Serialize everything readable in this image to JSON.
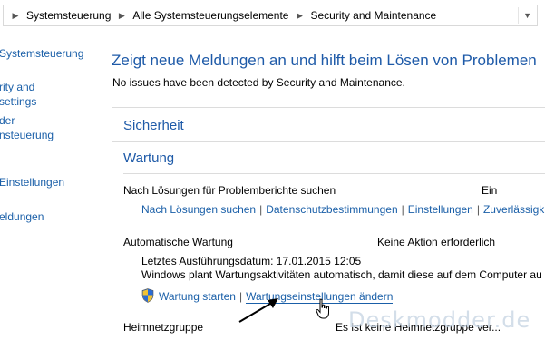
{
  "address_bar": {
    "crumbs": [
      "Systemsteuerung",
      "Alle Systemsteuerungselemente",
      "Security and Maintenance"
    ]
  },
  "left_pane": {
    "items": [
      {
        "lines": [
          "Systemsteuerung"
        ]
      },
      {
        "lines": [
          "rity and",
          "settings"
        ]
      },
      {
        "lines": [
          "der",
          "nsteuerung"
        ]
      },
      {
        "lines": [
          "Einstellungen"
        ]
      },
      {
        "lines": [
          "eldungen"
        ]
      }
    ]
  },
  "main": {
    "title": "Zeigt neue Meldungen an und hilft beim Lösen von Problemen",
    "subtitle": "No issues have been detected by Security and Maintenance.",
    "sections": {
      "security": "Sicherheit",
      "maintenance": "Wartung"
    },
    "problem_reports": {
      "label": "Nach Lösungen für Problemberichte suchen",
      "status": "Ein",
      "links": [
        "Nach Lösungen suchen",
        "Datenschutzbestimmungen",
        "Einstellungen",
        "Zuverlässigk"
      ]
    },
    "auto_maintenance": {
      "label": "Automatische Wartung",
      "status": "Keine Aktion erforderlich",
      "last_run": "Letztes Ausführungsdatum: 17.01.2015 12:05",
      "description": "Windows plant Wartungsaktivitäten automatisch, damit diese auf dem Computer au",
      "links": [
        "Wartung starten",
        "Wartungseinstellungen ändern"
      ]
    },
    "homegroup": {
      "label": "Heimnetzgruppe",
      "status": "Es ist keine Heimnetzgruppe ver..."
    }
  },
  "watermark": "Deskmodder.de",
  "colors": {
    "link": "#1a5fa8",
    "heading": "#1e5aa8",
    "divider": "#dcdcdc"
  }
}
